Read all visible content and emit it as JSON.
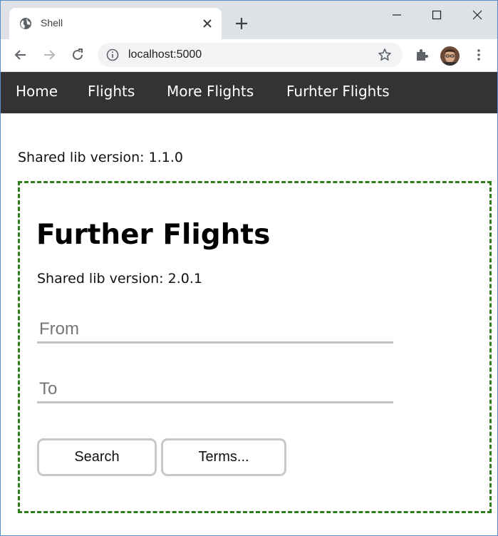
{
  "browser": {
    "tab": {
      "title": "Shell",
      "icon": "globe-icon"
    },
    "address": {
      "url": "localhost:5000"
    },
    "icons": [
      "back-arrow-icon",
      "forward-arrow-icon",
      "reload-icon",
      "info-icon",
      "star-icon",
      "puzzle-icon",
      "kebab-menu-icon"
    ]
  },
  "nav": {
    "items": [
      {
        "label": "Home"
      },
      {
        "label": "Flights"
      },
      {
        "label": "More Flights"
      },
      {
        "label": "Furhter Flights"
      }
    ]
  },
  "shell": {
    "version_text": "Shared lib version: 1.1.0"
  },
  "mfe": {
    "title": "Further Flights",
    "version_text": "Shared lib version: 2.0.1",
    "from_placeholder": "From",
    "to_placeholder": "To",
    "search_label": "Search",
    "terms_label": "Terms...",
    "border_color": "#2e7d1b"
  },
  "colors": {
    "navbar_bg": "#333333",
    "tabstrip_bg": "#dee1e6"
  }
}
